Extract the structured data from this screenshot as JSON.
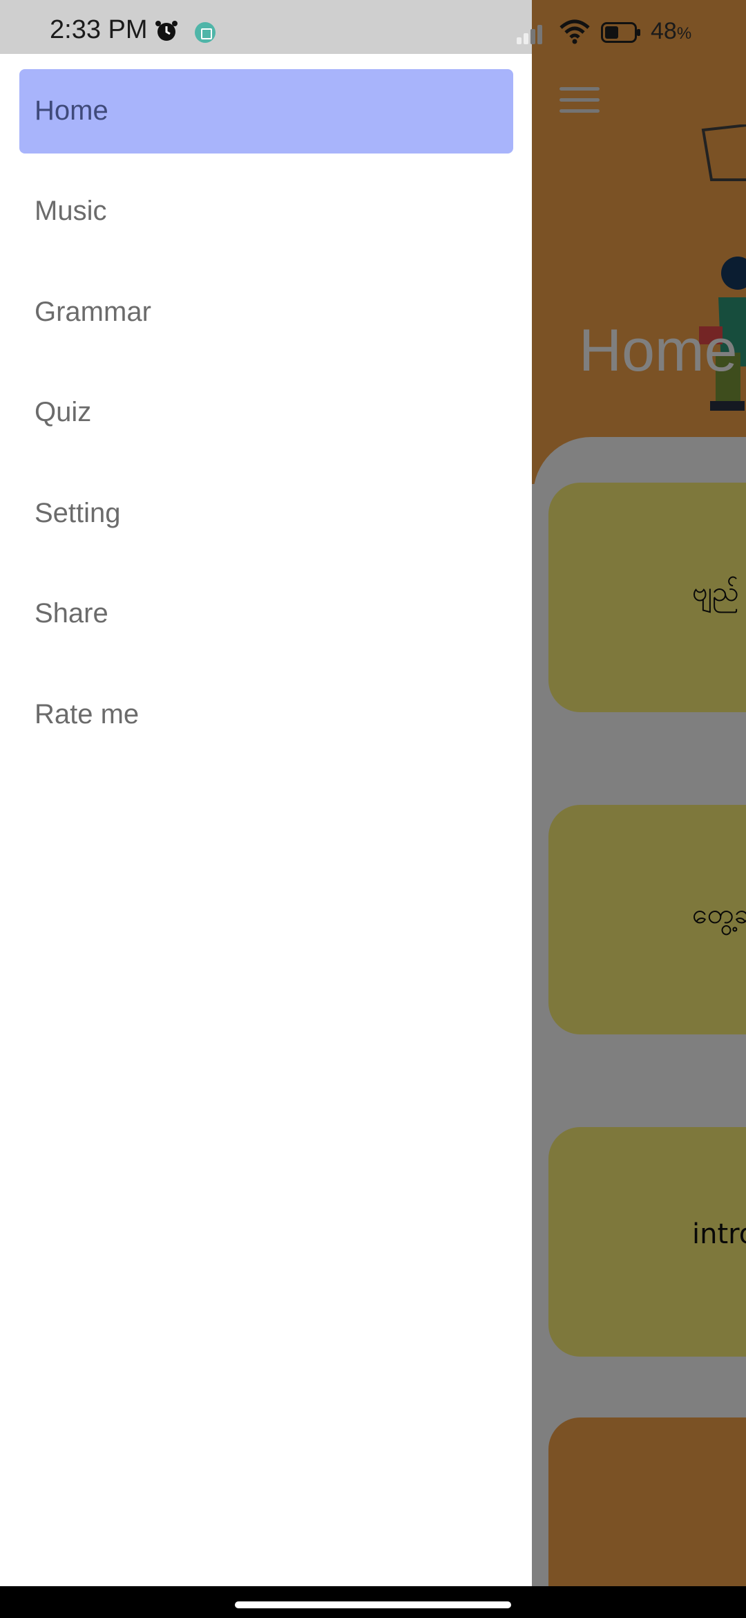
{
  "status_bar": {
    "time": "2:33 PM",
    "battery_percent": "48",
    "battery_unit": "%",
    "battery_level": 0.48,
    "icons": [
      "alarm-icon",
      "media-notification-icon",
      "signal-icon",
      "wifi-icon",
      "battery-icon"
    ]
  },
  "drawer": {
    "items": [
      {
        "label": "Home",
        "active": true
      },
      {
        "label": "Music",
        "active": false
      },
      {
        "label": "Grammar",
        "active": false
      },
      {
        "label": "Quiz",
        "active": false
      },
      {
        "label": "Setting",
        "active": false
      },
      {
        "label": "Share",
        "active": false
      },
      {
        "label": "Rate me",
        "active": false
      }
    ],
    "active_color": "#a8b4fb"
  },
  "app": {
    "title": "Home",
    "menu_icon": "hamburger-menu-icon",
    "header_color": "#f7a44a",
    "card_color": "#fdf078",
    "cards": [
      {
        "text": "ဗျည်"
      },
      {
        "text": "တွေ့ဆ"
      },
      {
        "text": "intro"
      },
      {
        "text": ""
      }
    ]
  },
  "colors": {
    "scrim": "rgba(0,0,0,0.5)",
    "text_secondary": "#6b6b6b"
  }
}
